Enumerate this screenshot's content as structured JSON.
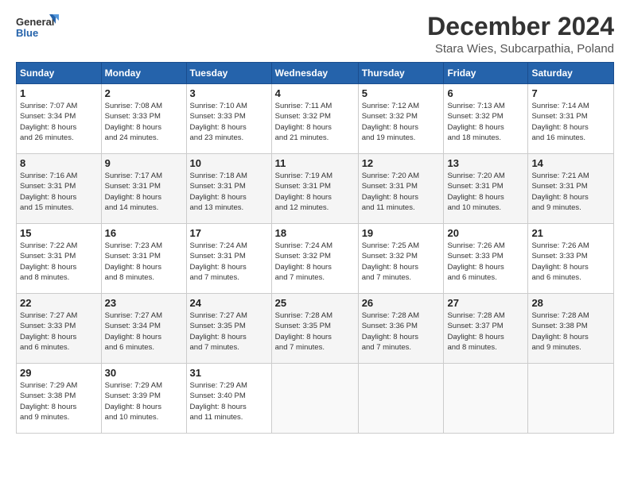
{
  "header": {
    "logo_line1": "General",
    "logo_line2": "Blue",
    "title": "December 2024",
    "subtitle": "Stara Wies, Subcarpathia, Poland"
  },
  "columns": [
    "Sunday",
    "Monday",
    "Tuesday",
    "Wednesday",
    "Thursday",
    "Friday",
    "Saturday"
  ],
  "weeks": [
    [
      {
        "day": "1",
        "sunrise": "7:07 AM",
        "sunset": "3:34 PM",
        "daylight": "8 hours and 26 minutes."
      },
      {
        "day": "2",
        "sunrise": "7:08 AM",
        "sunset": "3:33 PM",
        "daylight": "8 hours and 24 minutes."
      },
      {
        "day": "3",
        "sunrise": "7:10 AM",
        "sunset": "3:33 PM",
        "daylight": "8 hours and 23 minutes."
      },
      {
        "day": "4",
        "sunrise": "7:11 AM",
        "sunset": "3:32 PM",
        "daylight": "8 hours and 21 minutes."
      },
      {
        "day": "5",
        "sunrise": "7:12 AM",
        "sunset": "3:32 PM",
        "daylight": "8 hours and 19 minutes."
      },
      {
        "day": "6",
        "sunrise": "7:13 AM",
        "sunset": "3:32 PM",
        "daylight": "8 hours and 18 minutes."
      },
      {
        "day": "7",
        "sunrise": "7:14 AM",
        "sunset": "3:31 PM",
        "daylight": "8 hours and 16 minutes."
      }
    ],
    [
      {
        "day": "8",
        "sunrise": "7:16 AM",
        "sunset": "3:31 PM",
        "daylight": "8 hours and 15 minutes."
      },
      {
        "day": "9",
        "sunrise": "7:17 AM",
        "sunset": "3:31 PM",
        "daylight": "8 hours and 14 minutes."
      },
      {
        "day": "10",
        "sunrise": "7:18 AM",
        "sunset": "3:31 PM",
        "daylight": "8 hours and 13 minutes."
      },
      {
        "day": "11",
        "sunrise": "7:19 AM",
        "sunset": "3:31 PM",
        "daylight": "8 hours and 12 minutes."
      },
      {
        "day": "12",
        "sunrise": "7:20 AM",
        "sunset": "3:31 PM",
        "daylight": "8 hours and 11 minutes."
      },
      {
        "day": "13",
        "sunrise": "7:20 AM",
        "sunset": "3:31 PM",
        "daylight": "8 hours and 10 minutes."
      },
      {
        "day": "14",
        "sunrise": "7:21 AM",
        "sunset": "3:31 PM",
        "daylight": "8 hours and 9 minutes."
      }
    ],
    [
      {
        "day": "15",
        "sunrise": "7:22 AM",
        "sunset": "3:31 PM",
        "daylight": "8 hours and 8 minutes."
      },
      {
        "day": "16",
        "sunrise": "7:23 AM",
        "sunset": "3:31 PM",
        "daylight": "8 hours and 8 minutes."
      },
      {
        "day": "17",
        "sunrise": "7:24 AM",
        "sunset": "3:31 PM",
        "daylight": "8 hours and 7 minutes."
      },
      {
        "day": "18",
        "sunrise": "7:24 AM",
        "sunset": "3:32 PM",
        "daylight": "8 hours and 7 minutes."
      },
      {
        "day": "19",
        "sunrise": "7:25 AM",
        "sunset": "3:32 PM",
        "daylight": "8 hours and 7 minutes."
      },
      {
        "day": "20",
        "sunrise": "7:26 AM",
        "sunset": "3:33 PM",
        "daylight": "8 hours and 6 minutes."
      },
      {
        "day": "21",
        "sunrise": "7:26 AM",
        "sunset": "3:33 PM",
        "daylight": "8 hours and 6 minutes."
      }
    ],
    [
      {
        "day": "22",
        "sunrise": "7:27 AM",
        "sunset": "3:33 PM",
        "daylight": "8 hours and 6 minutes."
      },
      {
        "day": "23",
        "sunrise": "7:27 AM",
        "sunset": "3:34 PM",
        "daylight": "8 hours and 6 minutes."
      },
      {
        "day": "24",
        "sunrise": "7:27 AM",
        "sunset": "3:35 PM",
        "daylight": "8 hours and 7 minutes."
      },
      {
        "day": "25",
        "sunrise": "7:28 AM",
        "sunset": "3:35 PM",
        "daylight": "8 hours and 7 minutes."
      },
      {
        "day": "26",
        "sunrise": "7:28 AM",
        "sunset": "3:36 PM",
        "daylight": "8 hours and 7 minutes."
      },
      {
        "day": "27",
        "sunrise": "7:28 AM",
        "sunset": "3:37 PM",
        "daylight": "8 hours and 8 minutes."
      },
      {
        "day": "28",
        "sunrise": "7:28 AM",
        "sunset": "3:38 PM",
        "daylight": "8 hours and 9 minutes."
      }
    ],
    [
      {
        "day": "29",
        "sunrise": "7:29 AM",
        "sunset": "3:38 PM",
        "daylight": "8 hours and 9 minutes."
      },
      {
        "day": "30",
        "sunrise": "7:29 AM",
        "sunset": "3:39 PM",
        "daylight": "8 hours and 10 minutes."
      },
      {
        "day": "31",
        "sunrise": "7:29 AM",
        "sunset": "3:40 PM",
        "daylight": "8 hours and 11 minutes."
      },
      null,
      null,
      null,
      null
    ]
  ],
  "labels": {
    "sunrise": "Sunrise:",
    "sunset": "Sunset:",
    "daylight": "Daylight:"
  }
}
